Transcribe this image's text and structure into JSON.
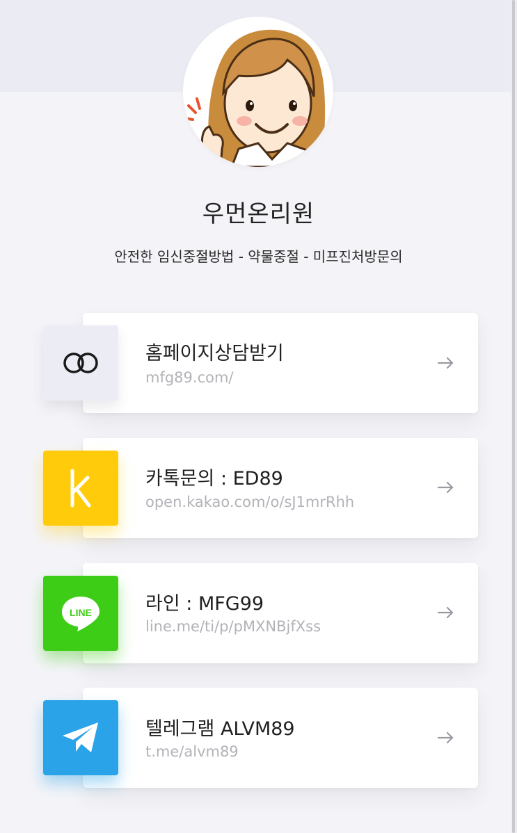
{
  "profile": {
    "name": "우먼온리원",
    "description": "안전한 임신중절방법 - 약물중절 - 미프진처방문의"
  },
  "links": [
    {
      "title": "홈페이지상담받기",
      "url": "mfg89.com/",
      "icon": "link-rings-icon",
      "color": "#ececf5"
    },
    {
      "title": "카톡문의 : ED89",
      "url": "open.kakao.com/o/sJ1mrRhh",
      "icon": "kakaotalk-icon",
      "icon_text": "k",
      "color": "#ffcb0a"
    },
    {
      "title": "라인  :  MFG99",
      "url": "line.me/ti/p/pMXNBjfXss",
      "icon": "line-icon",
      "icon_text": "LINE",
      "color": "#3ecd16"
    },
    {
      "title": "텔레그램 ALVM89",
      "url": "t.me/alvm89",
      "icon": "telegram-icon",
      "color": "#2aa3e8"
    }
  ]
}
